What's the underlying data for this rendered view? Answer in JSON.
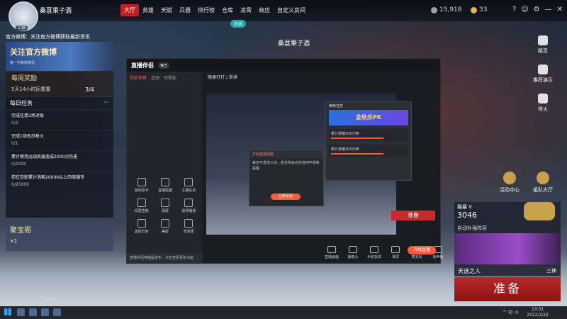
{
  "player": {
    "name": "桑葚果子酒",
    "level": "138"
  },
  "nav": {
    "tabs": [
      "大厅",
      "英雄",
      "天赋",
      "兵器",
      "排行榜",
      "仓库",
      "凌霄",
      "商店",
      "自定义房间"
    ]
  },
  "currency": {
    "silver": "15,918",
    "gold": "33"
  },
  "window_icons": [
    "?",
    "☺",
    "⚙",
    "—",
    "✕"
  ],
  "online_pill": "在线",
  "center_name": "桑葚果子酒",
  "news": {
    "label": "官方微博：关注官方微博获取最新资讯",
    "banner": "关注官方微博",
    "banner_sub": "第一手新鲜资讯"
  },
  "reward": {
    "title": "每周奖励",
    "sub": "5天14小时后重置",
    "count": "3/4"
  },
  "tasks": {
    "title": "每日任务",
    "items": [
      {
        "text": "完成任意2场对局",
        "progress": "0/2"
      },
      {
        "text": "完成1场无尽枪火",
        "progress": "0/1"
      },
      {
        "text": "累计使用远战武器造成2000点伤害",
        "progress": "0/2000"
      },
      {
        "text": "前往货郎累计消耗20000以上的暗潮币",
        "progress": "0/20000"
      }
    ]
  },
  "treasure": {
    "title": "聚宝阁",
    "count": "×1"
  },
  "app": {
    "logo": "直播伴侣",
    "badge": "官方",
    "side_tabs": [
      "我的场景",
      "互动",
      "可视化"
    ],
    "tools": [
      "游戏助手",
      "直播贴图",
      "主播任务",
      "投屏直播",
      "录屏",
      "视频播放",
      "虚拟形象",
      "美颜",
      "粉丝团"
    ],
    "notice": "直播伴侣电脑版发布：点击查看更多功能",
    "live_title": "随便打打 / 单排",
    "popup": {
      "head": "开启直播提醒",
      "body": "每天可发送三次，粉丝将会在抖音APP收到提醒",
      "btn": "立即设置"
    },
    "shop": {
      "head": "推荐任务",
      "banner": "金秋乐PK",
      "items": [
        "累计观播100分钟",
        "累计观播300分钟"
      ]
    },
    "bottom_tools": [
      "直播画面",
      "摄像头",
      "手机投屏",
      "录屏",
      "麦克风",
      "扬声器"
    ],
    "live_btn": "开始直播"
  },
  "right": {
    "icons": [
      "精灵",
      "推荐演示",
      "传火"
    ],
    "activity": "活动中心",
    "hall": "组队大厅"
  },
  "card": {
    "name": "猫暴 V",
    "score": "3046",
    "auto": "自动补强阵容",
    "hero": "天选之人",
    "tier": "三神"
  },
  "ready": {
    "big": "准备",
    "mini": "准备"
  },
  "hud": {
    "num": "8479"
  },
  "taskbar": {
    "time": "13:01",
    "date": "2022/2/22",
    "tray": "^ 中 ⊙"
  }
}
